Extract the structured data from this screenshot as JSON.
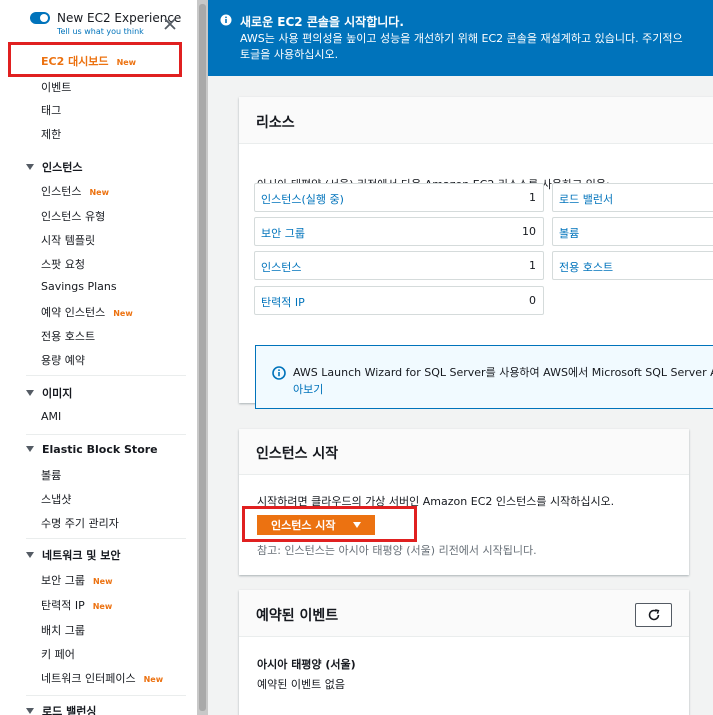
{
  "sidebar": {
    "new_experience_title": "New EC2 Experience",
    "new_experience_link": "Tell us what you think",
    "dashboard_label": "EC2 대시보드",
    "new_badge": "New",
    "top_items": [
      "이벤트",
      "태그",
      "제한"
    ],
    "sections": {
      "instances": {
        "title": "인스턴스",
        "items": [
          "인스턴스",
          "인스턴스 유형",
          "시작 템플릿",
          "스팟 요청",
          "Savings Plans",
          "예약 인스턴스",
          "전용 호스트",
          "용량 예약"
        ]
      },
      "images": {
        "title": "이미지",
        "items": [
          "AMI"
        ]
      },
      "ebs": {
        "title": "Elastic Block Store",
        "items": [
          "볼륨",
          "스냅샷",
          "수명 주기 관리자"
        ]
      },
      "network": {
        "title": "네트워크 및 보안",
        "items": [
          "보안 그룹",
          "탄력적 IP",
          "배치 그룹",
          "키 페어",
          "네트워크 인터페이스"
        ]
      },
      "lb": {
        "title": "로드 밸런싱"
      }
    }
  },
  "banner": {
    "title": "새로운 EC2 콘솔을 시작합니다.",
    "line1": "AWS는 사용 편의성을 높이고 성능을 개선하기 위해 EC2 콘솔을 재설계하고 있습니다. 주기적으",
    "line2": "토글을 사용하십시오."
  },
  "resources": {
    "title": "리소스",
    "description": "아시아 태평양 (서울) 리전에서 다음 Amazon EC2 리소스를 사용하고 있음:",
    "cells": [
      {
        "label": "인스턴스(실행 중)",
        "count": "1"
      },
      {
        "label": "로드 밸런서",
        "count": ""
      },
      {
        "label": "보안 그룹",
        "count": "10"
      },
      {
        "label": "볼륨",
        "count": ""
      },
      {
        "label": "인스턴스",
        "count": "1"
      },
      {
        "label": "전용 호스트",
        "count": ""
      },
      {
        "label": "탄력적 IP",
        "count": "0"
      }
    ],
    "info_line1": "AWS Launch Wizard for SQL Server를 사용하여 AWS에서 Microsoft SQL Server Alw",
    "info_line2": "아보기"
  },
  "launch": {
    "title": "인스턴스 시작",
    "description": "시작하려면 클라우드의 가상 서버인 Amazon EC2 인스턴스를 시작하십시오.",
    "button_label": "인스턴스 시작",
    "note": "참고: 인스턴스는 아시아 태평양 (서울) 리전에서 시작됩니다."
  },
  "events": {
    "title": "예약된 이벤트",
    "region": "아시아 태평양 (서울)",
    "empty_text": "예약된 이벤트 없음"
  },
  "colors": {
    "accent_orange": "#ec7211",
    "link_blue": "#0073bb",
    "banner_blue": "#0073bb",
    "highlight_red": "#e02020"
  }
}
